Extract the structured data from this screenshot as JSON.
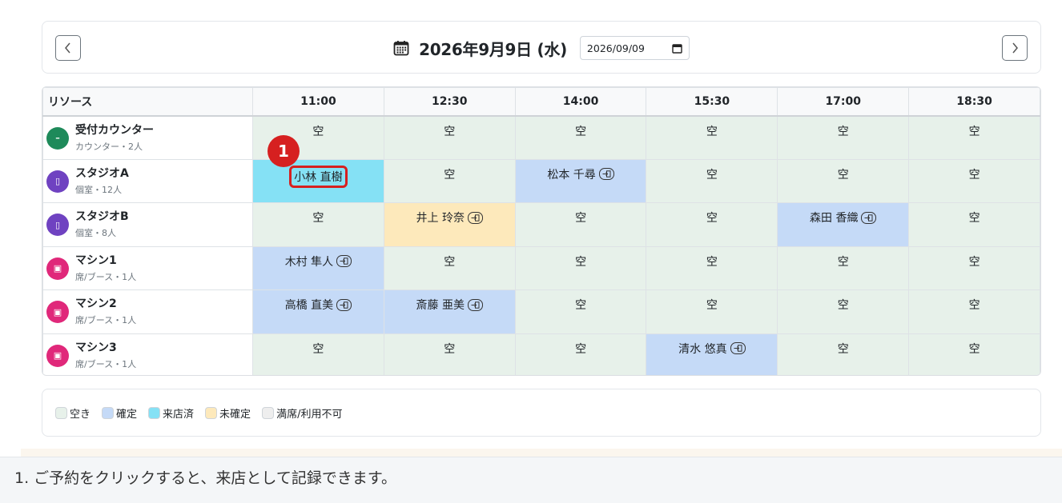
{
  "header": {
    "title": "2026年9月9日 (水)",
    "date_value": "2026/09/09"
  },
  "table": {
    "resource_header": "リソース",
    "times": [
      "11:00",
      "12:30",
      "14:00",
      "15:30",
      "17:00",
      "18:30"
    ],
    "rows": [
      {
        "name": "受付カウンター",
        "sub": "カウンター・2人",
        "icon": "counter-icon",
        "icon_color": "#1e8a5a",
        "icon_glyph": "–",
        "slots": [
          {
            "label": "空",
            "status": "empty"
          },
          {
            "label": "空",
            "status": "empty"
          },
          {
            "label": "空",
            "status": "empty"
          },
          {
            "label": "空",
            "status": "empty"
          },
          {
            "label": "空",
            "status": "empty"
          },
          {
            "label": "空",
            "status": "empty"
          }
        ]
      },
      {
        "name": "スタジオA",
        "sub": "個室・12人",
        "icon": "door-icon",
        "icon_color": "#6f42c1",
        "icon_glyph": "▯",
        "slots": [
          {
            "label": "小林 直樹",
            "status": "visited",
            "highlight": true
          },
          {
            "label": "空",
            "status": "empty"
          },
          {
            "label": "松本 千尋",
            "status": "confirmed",
            "checkin": true
          },
          {
            "label": "空",
            "status": "empty"
          },
          {
            "label": "空",
            "status": "empty"
          },
          {
            "label": "空",
            "status": "empty"
          }
        ]
      },
      {
        "name": "スタジオB",
        "sub": "個室・8人",
        "icon": "door-icon",
        "icon_color": "#6f42c1",
        "icon_glyph": "▯",
        "slots": [
          {
            "label": "空",
            "status": "empty"
          },
          {
            "label": "井上 玲奈",
            "status": "pending",
            "checkin": true
          },
          {
            "label": "空",
            "status": "empty"
          },
          {
            "label": "空",
            "status": "empty"
          },
          {
            "label": "森田 香織",
            "status": "confirmed",
            "checkin": true
          },
          {
            "label": "空",
            "status": "empty"
          }
        ]
      },
      {
        "name": "マシン1",
        "sub": "席/ブース・1人",
        "icon": "seat-icon",
        "icon_color": "#e0287a",
        "icon_glyph": "▣",
        "slots": [
          {
            "label": "木村 隼人",
            "status": "confirmed",
            "checkin": true
          },
          {
            "label": "空",
            "status": "empty"
          },
          {
            "label": "空",
            "status": "empty"
          },
          {
            "label": "空",
            "status": "empty"
          },
          {
            "label": "空",
            "status": "empty"
          },
          {
            "label": "空",
            "status": "empty"
          }
        ]
      },
      {
        "name": "マシン2",
        "sub": "席/ブース・1人",
        "icon": "seat-icon",
        "icon_color": "#e0287a",
        "icon_glyph": "▣",
        "slots": [
          {
            "label": "高橋 直美",
            "status": "confirmed",
            "checkin": true
          },
          {
            "label": "斎藤 亜美",
            "status": "confirmed",
            "checkin": true
          },
          {
            "label": "空",
            "status": "empty"
          },
          {
            "label": "空",
            "status": "empty"
          },
          {
            "label": "空",
            "status": "empty"
          },
          {
            "label": "空",
            "status": "empty"
          }
        ]
      },
      {
        "name": "マシン3",
        "sub": "席/ブース・1人",
        "icon": "seat-icon",
        "icon_color": "#e0287a",
        "icon_glyph": "▣",
        "slots": [
          {
            "label": "空",
            "status": "empty"
          },
          {
            "label": "空",
            "status": "empty"
          },
          {
            "label": "空",
            "status": "empty"
          },
          {
            "label": "清水 悠真",
            "status": "confirmed",
            "checkin": true
          },
          {
            "label": "空",
            "status": "empty"
          },
          {
            "label": "空",
            "status": "empty"
          }
        ]
      }
    ]
  },
  "legend": [
    {
      "label": "空き",
      "color": "#e7f1ea"
    },
    {
      "label": "確定",
      "color": "#c5daf7"
    },
    {
      "label": "来店済",
      "color": "#85e1f5"
    },
    {
      "label": "未確定",
      "color": "#fde9bb"
    },
    {
      "label": "満席/利用不可",
      "color": "#eeeeee"
    }
  ],
  "annotation": {
    "marker": "1",
    "caption": "1. ご予約をクリックすると、来店として記録できます。"
  }
}
